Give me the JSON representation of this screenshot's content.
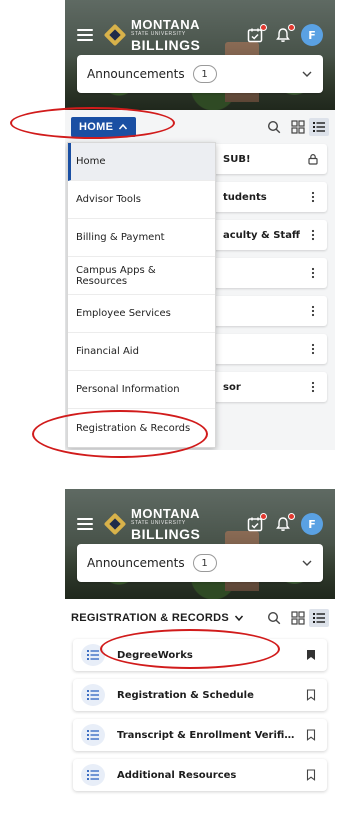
{
  "header": {
    "logo_top": "MONTANA",
    "logo_mid": "STATE UNIVERSITY",
    "logo_bottom": "BILLINGS",
    "avatar_initial": "F"
  },
  "announcements": {
    "label": "Announcements",
    "count": "1"
  },
  "panel1": {
    "section_button": "HOME",
    "cards": [
      {
        "text": "SUB!",
        "action": "lock-icon"
      },
      {
        "text": "tudents",
        "action": "more-vertical-icon"
      },
      {
        "text": "aculty & Staff",
        "action": "more-vertical-icon"
      },
      {
        "text": "",
        "action": "more-vertical-icon"
      },
      {
        "text": "",
        "action": "more-vertical-icon"
      },
      {
        "text": "",
        "action": "more-vertical-icon"
      },
      {
        "text": "sor",
        "action": "more-vertical-icon"
      }
    ],
    "dropdown": [
      "Home",
      "Advisor Tools",
      "Billing & Payment",
      "Campus Apps & Resources",
      "Employee Services",
      "Financial Aid",
      "Personal Information",
      "Registration & Records"
    ]
  },
  "panel2": {
    "section_title": "REGISTRATION & RECORDS",
    "items": [
      {
        "text": "DegreeWorks",
        "bookmarked": true
      },
      {
        "text": "Registration & Schedule",
        "bookmarked": false
      },
      {
        "text": "Transcript & Enrollment Verification",
        "bookmarked": false
      },
      {
        "text": "Additional Resources",
        "bookmarked": false
      }
    ]
  },
  "colors": {
    "primary_blue": "#1a4fa3",
    "highlight_red": "#d11b1b",
    "avatar_blue": "#5aa1e3",
    "notification_red": "#e2382f"
  }
}
